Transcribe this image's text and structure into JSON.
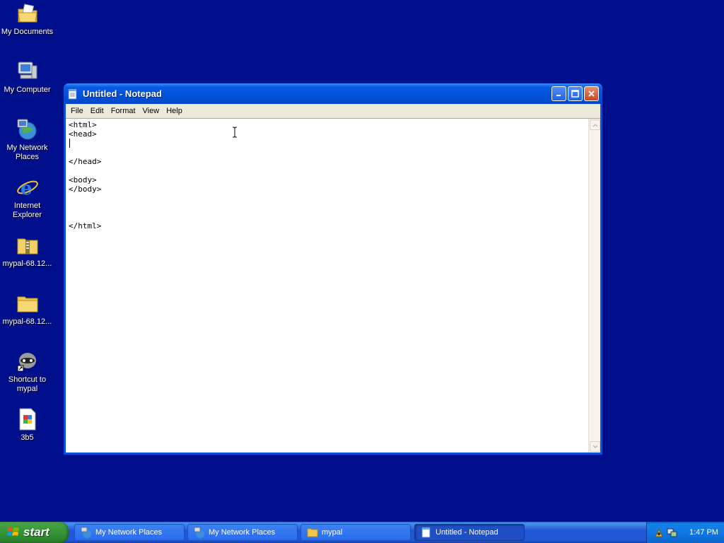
{
  "desktop": {
    "icons": [
      {
        "label": "My Documents",
        "icon": "my-documents-icon"
      },
      {
        "label": "My Computer",
        "icon": "my-computer-icon"
      },
      {
        "label": "My Network\nPlaces",
        "icon": "network-places-icon"
      },
      {
        "label": "Internet\nExplorer",
        "icon": "internet-explorer-icon"
      },
      {
        "label": "mypal-68.12...",
        "icon": "zip-folder-icon"
      },
      {
        "label": "mypal-68.12...",
        "icon": "folder-icon"
      },
      {
        "label": "Shortcut to\nmypal",
        "icon": "mypal-shortcut-icon"
      },
      {
        "label": "3b5",
        "icon": "image-file-icon"
      }
    ]
  },
  "notepad": {
    "title": "Untitled - Notepad",
    "menu": [
      "File",
      "Edit",
      "Format",
      "View",
      "Help"
    ],
    "content": "<html>\n<head>\n\n\n</head>\n\n<body>\n</body>\n\n\n\n</html>"
  },
  "taskbar": {
    "start_label": "start",
    "tasks": [
      {
        "label": "My Network Places",
        "icon": "network-places-icon",
        "active": false
      },
      {
        "label": "My Network Places",
        "icon": "network-places-icon",
        "active": false
      },
      {
        "label": "mypal",
        "icon": "folder-icon",
        "active": false
      },
      {
        "label": "Untitled - Notepad",
        "icon": "notepad-icon",
        "active": true
      }
    ],
    "clock": "1:47 PM"
  },
  "colors": {
    "desktop_background": "#000f8c",
    "title_bar": "#0052d9",
    "taskbar": "#2157d7",
    "start_button": "#3c9c3c"
  }
}
